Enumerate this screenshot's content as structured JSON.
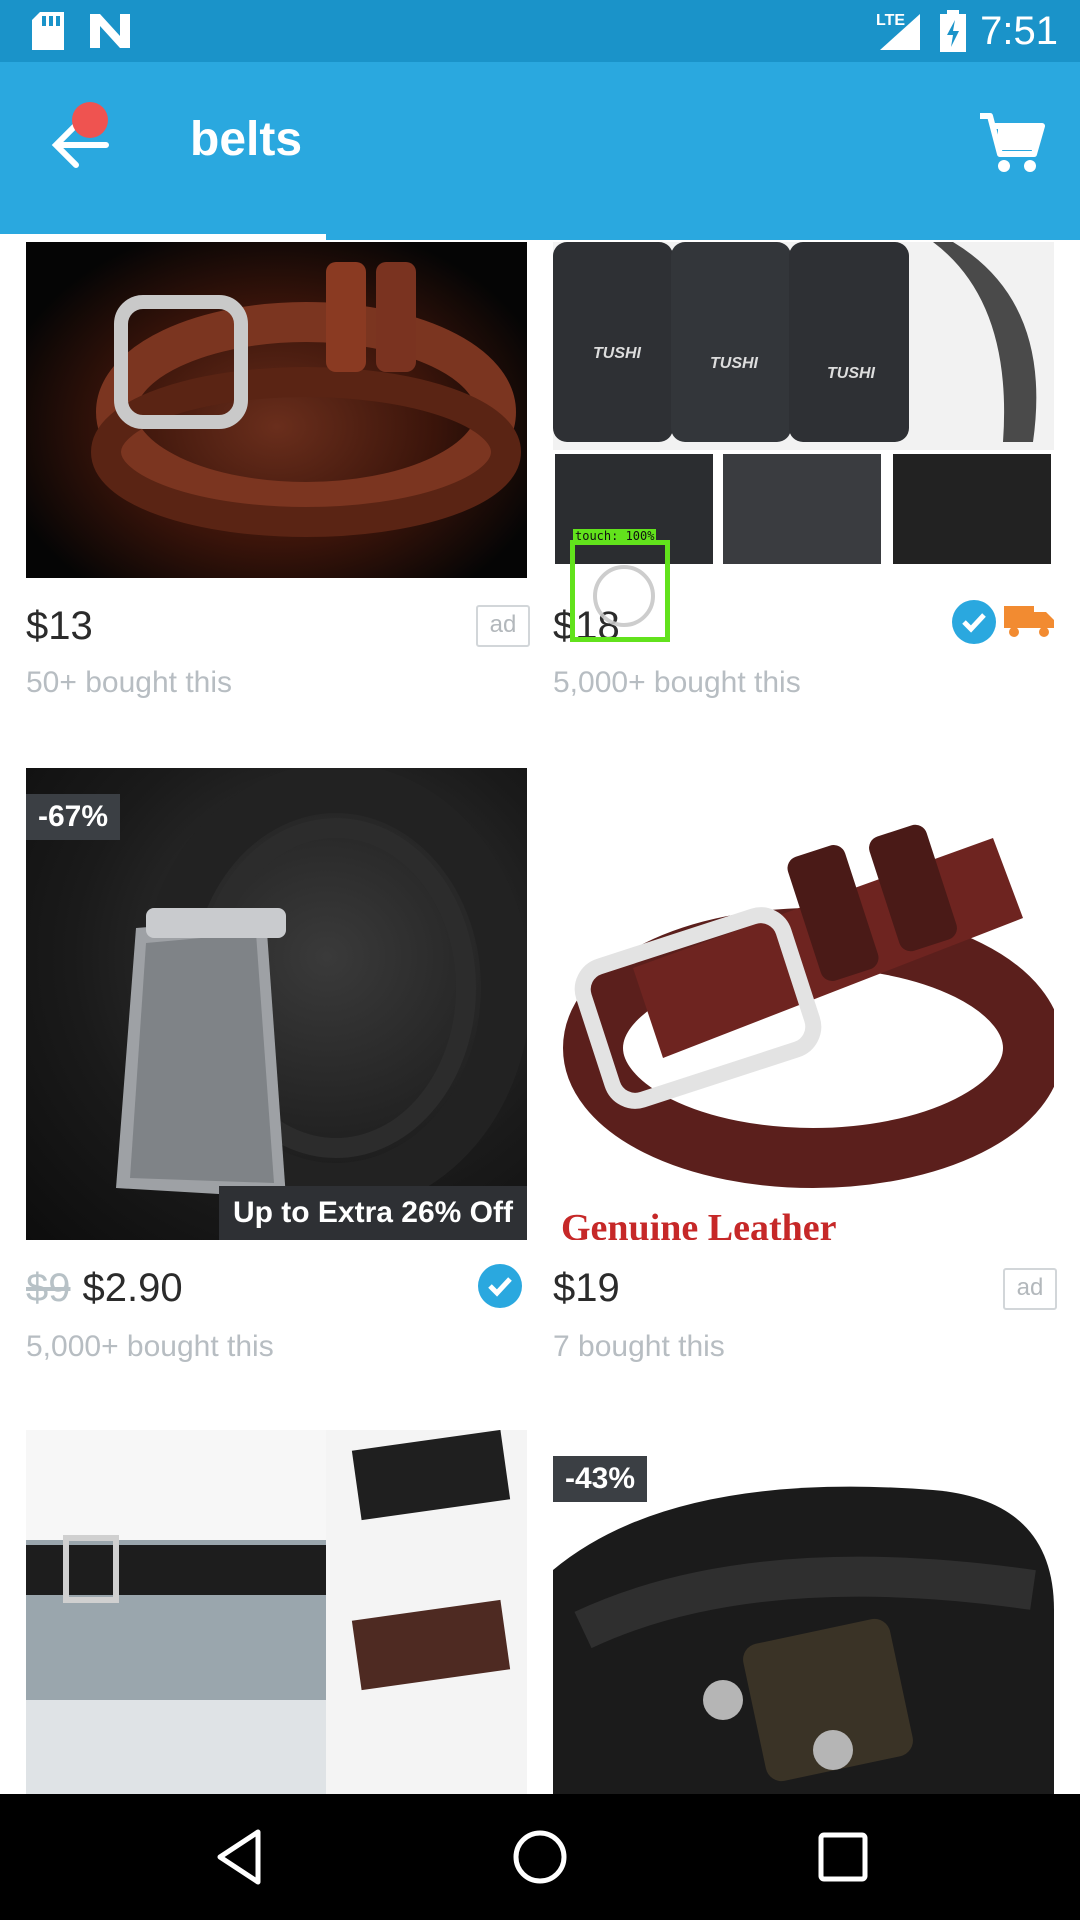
{
  "status": {
    "time": "7:51",
    "network": "LTE"
  },
  "appbar": {
    "title": "belts"
  },
  "products": [
    {
      "price": "$13",
      "bought": "50+ bought this",
      "ad": "ad"
    },
    {
      "price": "$18",
      "bought": "5,000+ bought this",
      "brand": "TUSHI"
    },
    {
      "old_price": "$9",
      "price": "$2.90",
      "bought": "5,000+ bought this",
      "discount": "-67%",
      "promo": "Up to Extra 26% Off"
    },
    {
      "price": "$19",
      "bought": "7 bought this",
      "ad": "ad",
      "caption": "Genuine Leather"
    },
    {
      "discount": "-43%"
    }
  ],
  "touch": {
    "label": "touch: 100%"
  },
  "colors": {
    "accent": "#2aa8df",
    "status": "#1a93c9",
    "touch": "#62e21c"
  },
  "icons": [
    "sd-card-icon",
    "n-icon",
    "signal-icon",
    "battery-icon",
    "back-arrow-icon",
    "cart-icon",
    "verified-icon",
    "shipping-truck-icon",
    "nav-back-icon",
    "nav-home-icon",
    "nav-recents-icon"
  ]
}
